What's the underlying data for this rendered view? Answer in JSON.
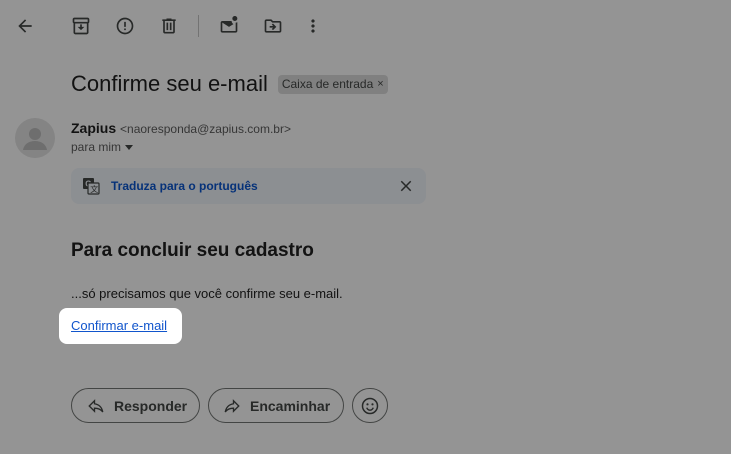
{
  "toolbar": {
    "icons": [
      "back-arrow-icon",
      "archive-icon",
      "report-spam-icon",
      "delete-icon",
      "mark-unread-icon",
      "move-to-icon",
      "more-vert-icon"
    ]
  },
  "email": {
    "subject": "Confirme seu e-mail",
    "label": "Caixa de entrada",
    "label_close": "×",
    "sender_name": "Zapius",
    "sender_email": "<naoresponda@zapius.com.br>",
    "recipient": "para mim"
  },
  "translate": {
    "link": "Traduza para o português"
  },
  "body": {
    "heading": "Para concluir seu cadastro",
    "text": "...só precisamos que você confirme seu e-mail.",
    "confirm_link": "Confirmar e-mail"
  },
  "actions": {
    "reply": "Responder",
    "forward": "Encaminhar"
  },
  "colors": {
    "link": "#1155cc",
    "translate_link": "#0b57d0",
    "overlay": "rgba(0,0,0,0.42)"
  }
}
